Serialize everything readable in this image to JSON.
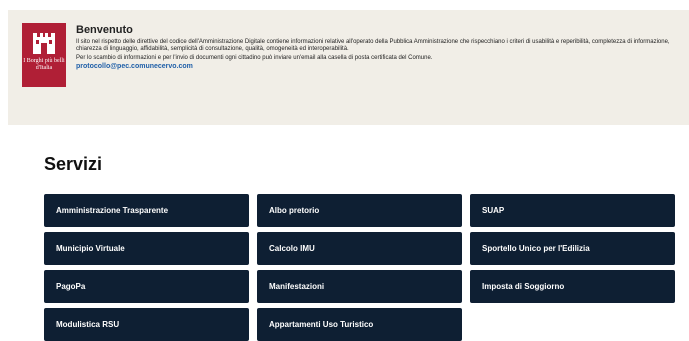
{
  "welcome": {
    "logo_text": "I Borghi più belli d'Italia",
    "title": "Benvenuto",
    "text": "Il sito nel rispetto delle direttive del codice dell'Amministrazione Digitale contiene informazioni relative all'operato della Pubblica Amministrazione che rispecchiano i criteri di usabilità e reperibilità, completezza di informazione, chiarezza di linguaggio, affidabilità, semplicità di consultazione, qualità, omogeneità ed interoperabilità.",
    "text2": "Per lo scambio di informazioni e per l'invio di documenti ogni cittadino può inviare un'email alla casella di posta certificata del Comune.",
    "email": "protocollo@pec.comunecervo.com",
    "accent": "#b01f36"
  },
  "services": {
    "title": "Servizi",
    "button_color": "#0e1f33",
    "items": [
      "Amministrazione Trasparente",
      "Albo pretorio",
      "SUAP",
      "Municipio Virtuale",
      "Calcolo IMU",
      "Sportello Unico per l'Edilizia",
      "PagoPa",
      "Manifestazioni",
      "Imposta di Soggiorno",
      "Modulistica RSU",
      "Appartamenti Uso Turistico"
    ]
  }
}
